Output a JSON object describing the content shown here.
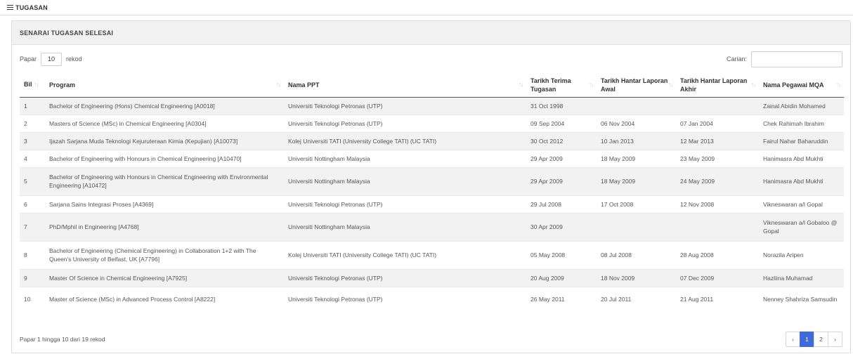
{
  "topbar": {
    "title": "TUGASAN",
    "icon": "list-icon"
  },
  "card": {
    "title": "SENARAI TUGASAN SELESAI"
  },
  "length": {
    "before": "Papar",
    "value": "10",
    "after": "rekod"
  },
  "search": {
    "label": "Carian:",
    "value": ""
  },
  "columns": [
    "Bil",
    "Program",
    "Nama PPT",
    "Tarikh Terima Tugasan",
    "Tarikh Hantar Laporan Awal",
    "Tarikh Hantar Laporan Akhir",
    "Nama Pegawai MQA"
  ],
  "rows": [
    {
      "bil": "1",
      "program": "Bachelor of Engineering (Hons) Chemical Engineering [A0018]",
      "ppt": "Universiti Teknologi Petronas (UTP)",
      "terima": "31 Oct 1998",
      "awal": "",
      "akhir": "",
      "pegawai": "Zainal Abidin Mohamed"
    },
    {
      "bil": "2",
      "program": "Masters of Science (MSc) in Chemical Engineering [A0304]",
      "ppt": "Universiti Teknologi Petronas (UTP)",
      "terima": "09 Sep 2004",
      "awal": "06 Nov 2004",
      "akhir": "07 Jan 2004",
      "pegawai": "Chek Rahimah Ibrahim"
    },
    {
      "bil": "3",
      "program": "Ijazah Sarjana Muda Teknologi Kejuruteraan Kimia (Kepujian) [A10073]",
      "ppt": "Kolej Universiti TATI (University College TATI) (UC TATI)",
      "terima": "30 Oct 2012",
      "awal": "10 Jan 2013",
      "akhir": "12 Mar 2013",
      "pegawai": "Fairul Nahar Baharuddin"
    },
    {
      "bil": "4",
      "program": "Bachelor of Engineering with Honours in Chemical Engineering [A10470]",
      "ppt": "Universiti Nottingham Malaysia",
      "terima": "29 Apr 2009",
      "awal": "18 May 2009",
      "akhir": "23 May 2009",
      "pegawai": "Hanimasra Abd Mukhti"
    },
    {
      "bil": "5",
      "program": "Bachelor of Engineering with Honours in Chemical Engineering with Environmental Engineering [A10472]",
      "ppt": "Universiti Nottingham Malaysia",
      "terima": "29 Apr 2009",
      "awal": "18 May 2009",
      "akhir": "24 May 2009",
      "pegawai": "Hanimasra Abd Mukhti"
    },
    {
      "bil": "6",
      "program": "Sarjana Sains Integrasi Proses [A4369]",
      "ppt": "Universiti Teknologi Petronas (UTP)",
      "terima": "29 Jul 2008",
      "awal": "17 Oct 2008",
      "akhir": "12 Nov 2008",
      "pegawai": "Vikneswaran a/l Gopal"
    },
    {
      "bil": "7",
      "program": "PhD/Mphil in Engineering [A4768]",
      "ppt": "Universiti Nottingham Malaysia",
      "terima": "30 Apr 2009",
      "awal": "",
      "akhir": "",
      "pegawai": "Vikneswaran a/l Gobaloo @ Gopal"
    },
    {
      "bil": "8",
      "program": "Bachelor of Engineering (Chemical Engineering) in Collaboration 1+2 with The Queen's University of Belfast, UK [A7796]",
      "ppt": "Kolej Universiti TATI (University College TATI) (UC TATI)",
      "terima": "05 May 2008",
      "awal": "08 Jul 2008",
      "akhir": "28 Aug 2008",
      "pegawai": "Norazila Aripen"
    },
    {
      "bil": "9",
      "program": "Master Of Science in Chemical Engineering [A7925]",
      "ppt": "Universiti Teknologi Petronas (UTP)",
      "terima": "20 Aug 2009",
      "awal": "18 Nov 2009",
      "akhir": "07 Dec 2009",
      "pegawai": "Hazliina Muhamad"
    },
    {
      "bil": "10",
      "program": "Master of Science (MSc) in Advanced Process Control [A8222]",
      "ppt": "Universiti Teknologi Petronas (UTP)",
      "terima": "26 May 2011",
      "awal": "20 Jul 2011",
      "akhir": "21 Aug 2011",
      "pegawai": "Nenney Shahriza Samsudin"
    }
  ],
  "footer": {
    "info": "Papar 1 hingga 10 dari 19 rekod"
  },
  "pagination": {
    "prev": "‹",
    "pages": [
      "1",
      "2"
    ],
    "next": "›",
    "active_color": "#3f6ad8"
  }
}
